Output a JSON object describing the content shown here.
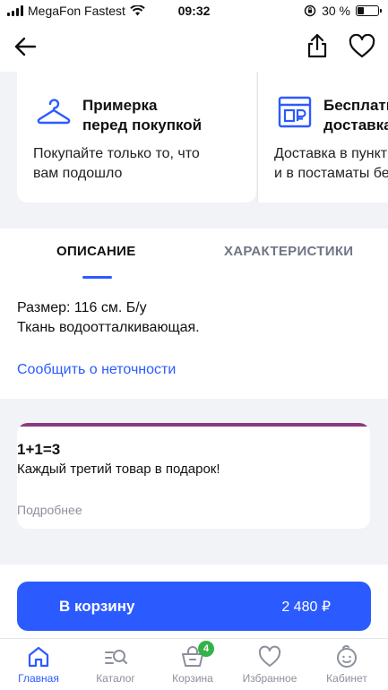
{
  "status_bar": {
    "carrier": "MegaFon Fastest",
    "time": "09:32",
    "battery": "30 %"
  },
  "features": [
    {
      "title": "Примерка\nперед покупкой",
      "description": "Покупайте только то, что\nвам подошло",
      "icon": "hanger-icon"
    },
    {
      "title": "Бесплатная\nдоставка",
      "description": "Доставка в пункты выдачи\nи в постаматы бесплатно",
      "icon": "parcel-locker-icon"
    }
  ],
  "tabs": {
    "description": "ОПИСАНИЕ",
    "characteristics": "ХАРАКТЕРИСТИКИ"
  },
  "description": {
    "line1": "Размер: 116 см. Б/у",
    "line2": "Ткань водоотталкивающая."
  },
  "report_link": "Сообщить о неточности",
  "promo": {
    "title": "1+1=3",
    "subtitle": "Каждый третий товар в подарок!",
    "more": "Подробнее",
    "accent_color": "#8a3a7e"
  },
  "cart_button": {
    "label": "В корзину",
    "price": "2 480 ₽"
  },
  "bottom_nav": [
    {
      "label": "Главная",
      "icon": "home-icon",
      "active": true
    },
    {
      "label": "Каталог",
      "icon": "catalog-search-icon",
      "active": false
    },
    {
      "label": "Корзина",
      "icon": "basket-icon",
      "active": false,
      "badge": "4"
    },
    {
      "label": "Избранное",
      "icon": "heart-icon",
      "active": false
    },
    {
      "label": "Кабинет",
      "icon": "profile-icon",
      "active": false
    }
  ],
  "colors": {
    "accent": "#2b5bff",
    "badge": "#34b24a"
  }
}
